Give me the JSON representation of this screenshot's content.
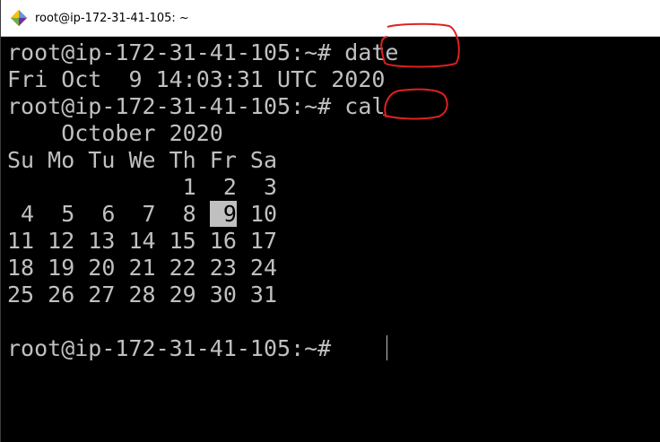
{
  "window": {
    "title": "root@ip-172-31-41-105: ~",
    "app_icon": "git-bash-diamond-icon"
  },
  "terminal": {
    "lines": [
      "root@ip-172-31-41-105:~# date",
      "Fri Oct  9 14:03:31 UTC 2020",
      "root@ip-172-31-41-105:~# cal",
      "    October 2020",
      "Su Mo Tu We Th Fr Sa",
      "             1  2  3",
      " 4  5  6  7  8 ",
      "11 12 13 14 15 16 17",
      "18 19 20 21 22 23 24",
      "25 26 27 28 29 30 31",
      "",
      "root@ip-172-31-41-105:~# "
    ],
    "today_highlight": " 9",
    "today_tail": " 10",
    "colors": {
      "background": "#000000",
      "foreground": "#c0c0c0",
      "highlight_bg": "#c0c0c0",
      "annotation": "#e02020"
    }
  }
}
